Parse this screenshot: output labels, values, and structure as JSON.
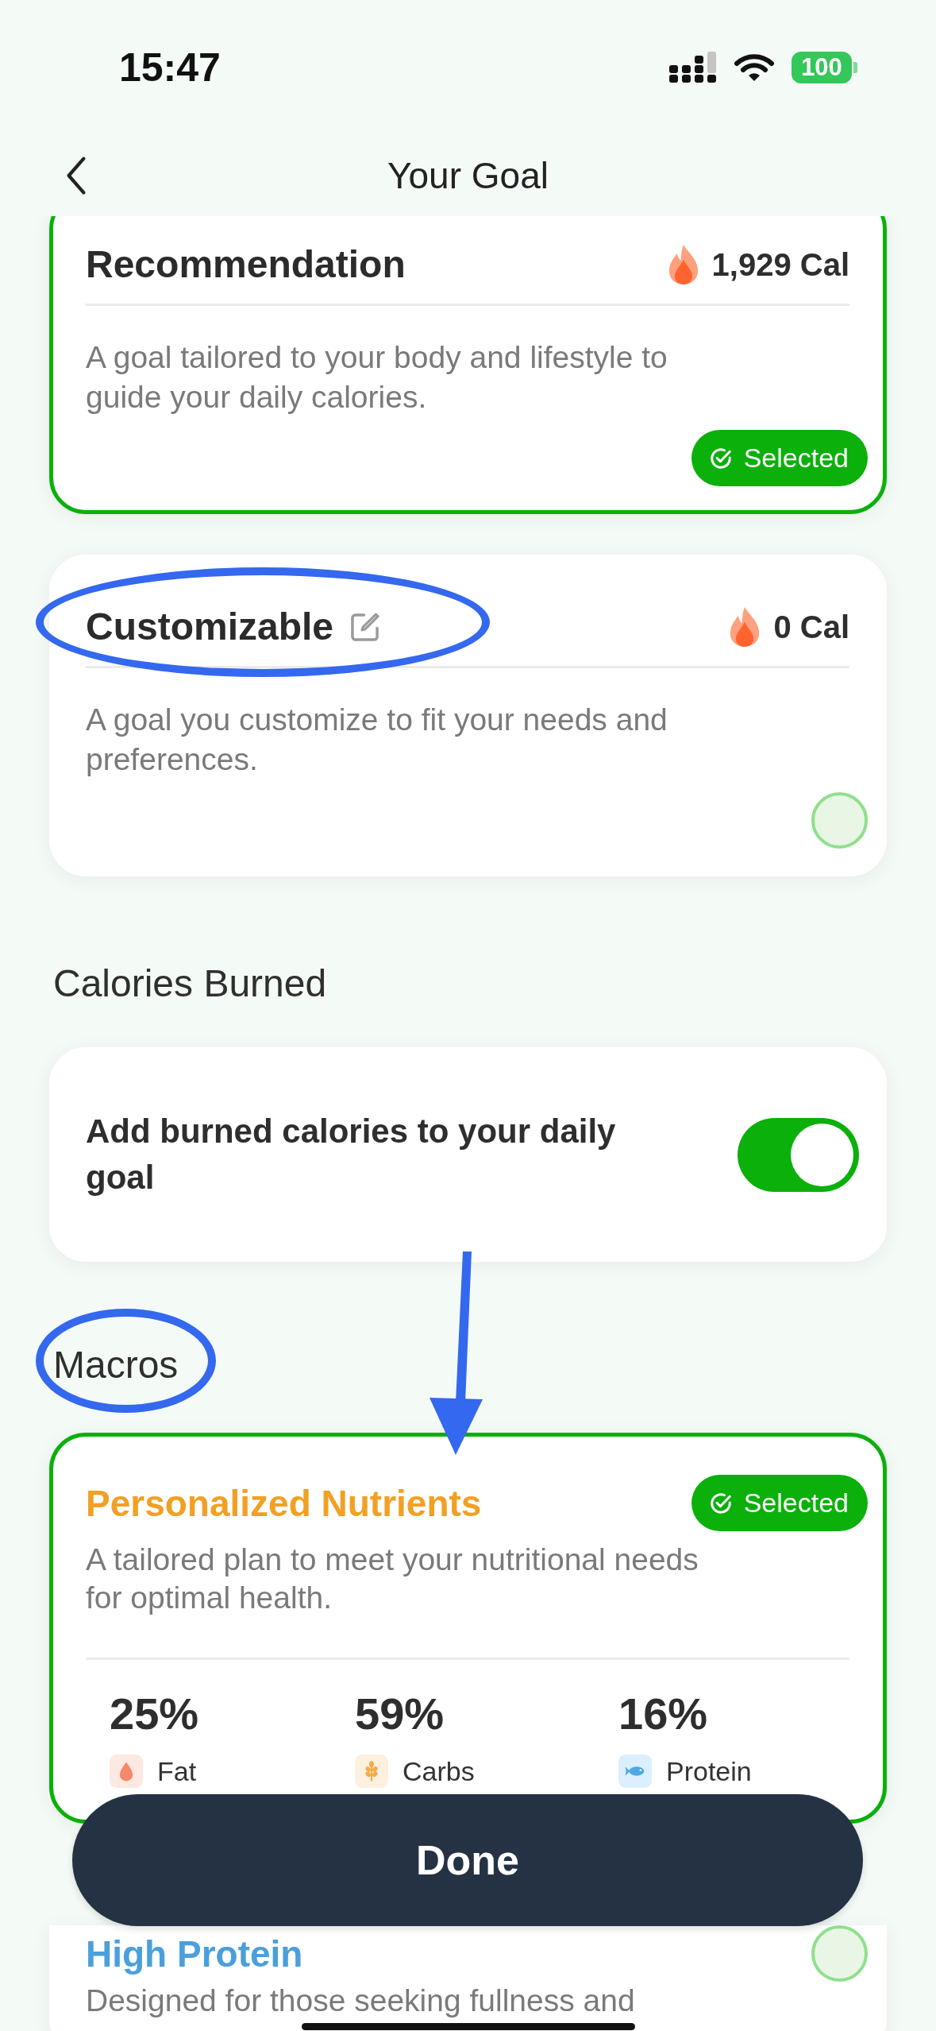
{
  "status_bar": {
    "time": "15:47",
    "battery": "100"
  },
  "header": {
    "title": "Your Goal"
  },
  "goal_options": [
    {
      "title": "Recommendation",
      "editable": false,
      "circled": false,
      "calories": "1,929 Cal",
      "description": "A goal tailored to your body and lifestyle to guide your daily calories.",
      "selected": true,
      "badge": "Selected"
    },
    {
      "title": "Customizable",
      "editable": true,
      "circled": true,
      "calories": "0 Cal",
      "description": "A goal you customize to fit your needs and preferences.",
      "selected": false
    }
  ],
  "calories_burned": {
    "heading": "Calories Burned",
    "label": "Add burned calories to your daily goal",
    "on": true
  },
  "macros": {
    "heading": "Macros",
    "circled": true,
    "arrow": true,
    "plans": [
      {
        "title": "Personalized Nutrients",
        "color": "#f2a024",
        "selected": true,
        "badge": "Selected",
        "description": "A tailored plan to meet your nutritional needs for optimal health.",
        "breakdown": [
          {
            "kind": "fat",
            "percent": "25%",
            "label": "Fat"
          },
          {
            "kind": "carbs",
            "percent": "59%",
            "label": "Carbs"
          },
          {
            "kind": "protein",
            "percent": "16%",
            "label": "Protein"
          }
        ]
      },
      {
        "title": "High Protein",
        "color": "#4a9fdc",
        "selected": false,
        "description": "Designed for those seeking fullness and"
      }
    ]
  },
  "done_button": {
    "label": "Done"
  }
}
